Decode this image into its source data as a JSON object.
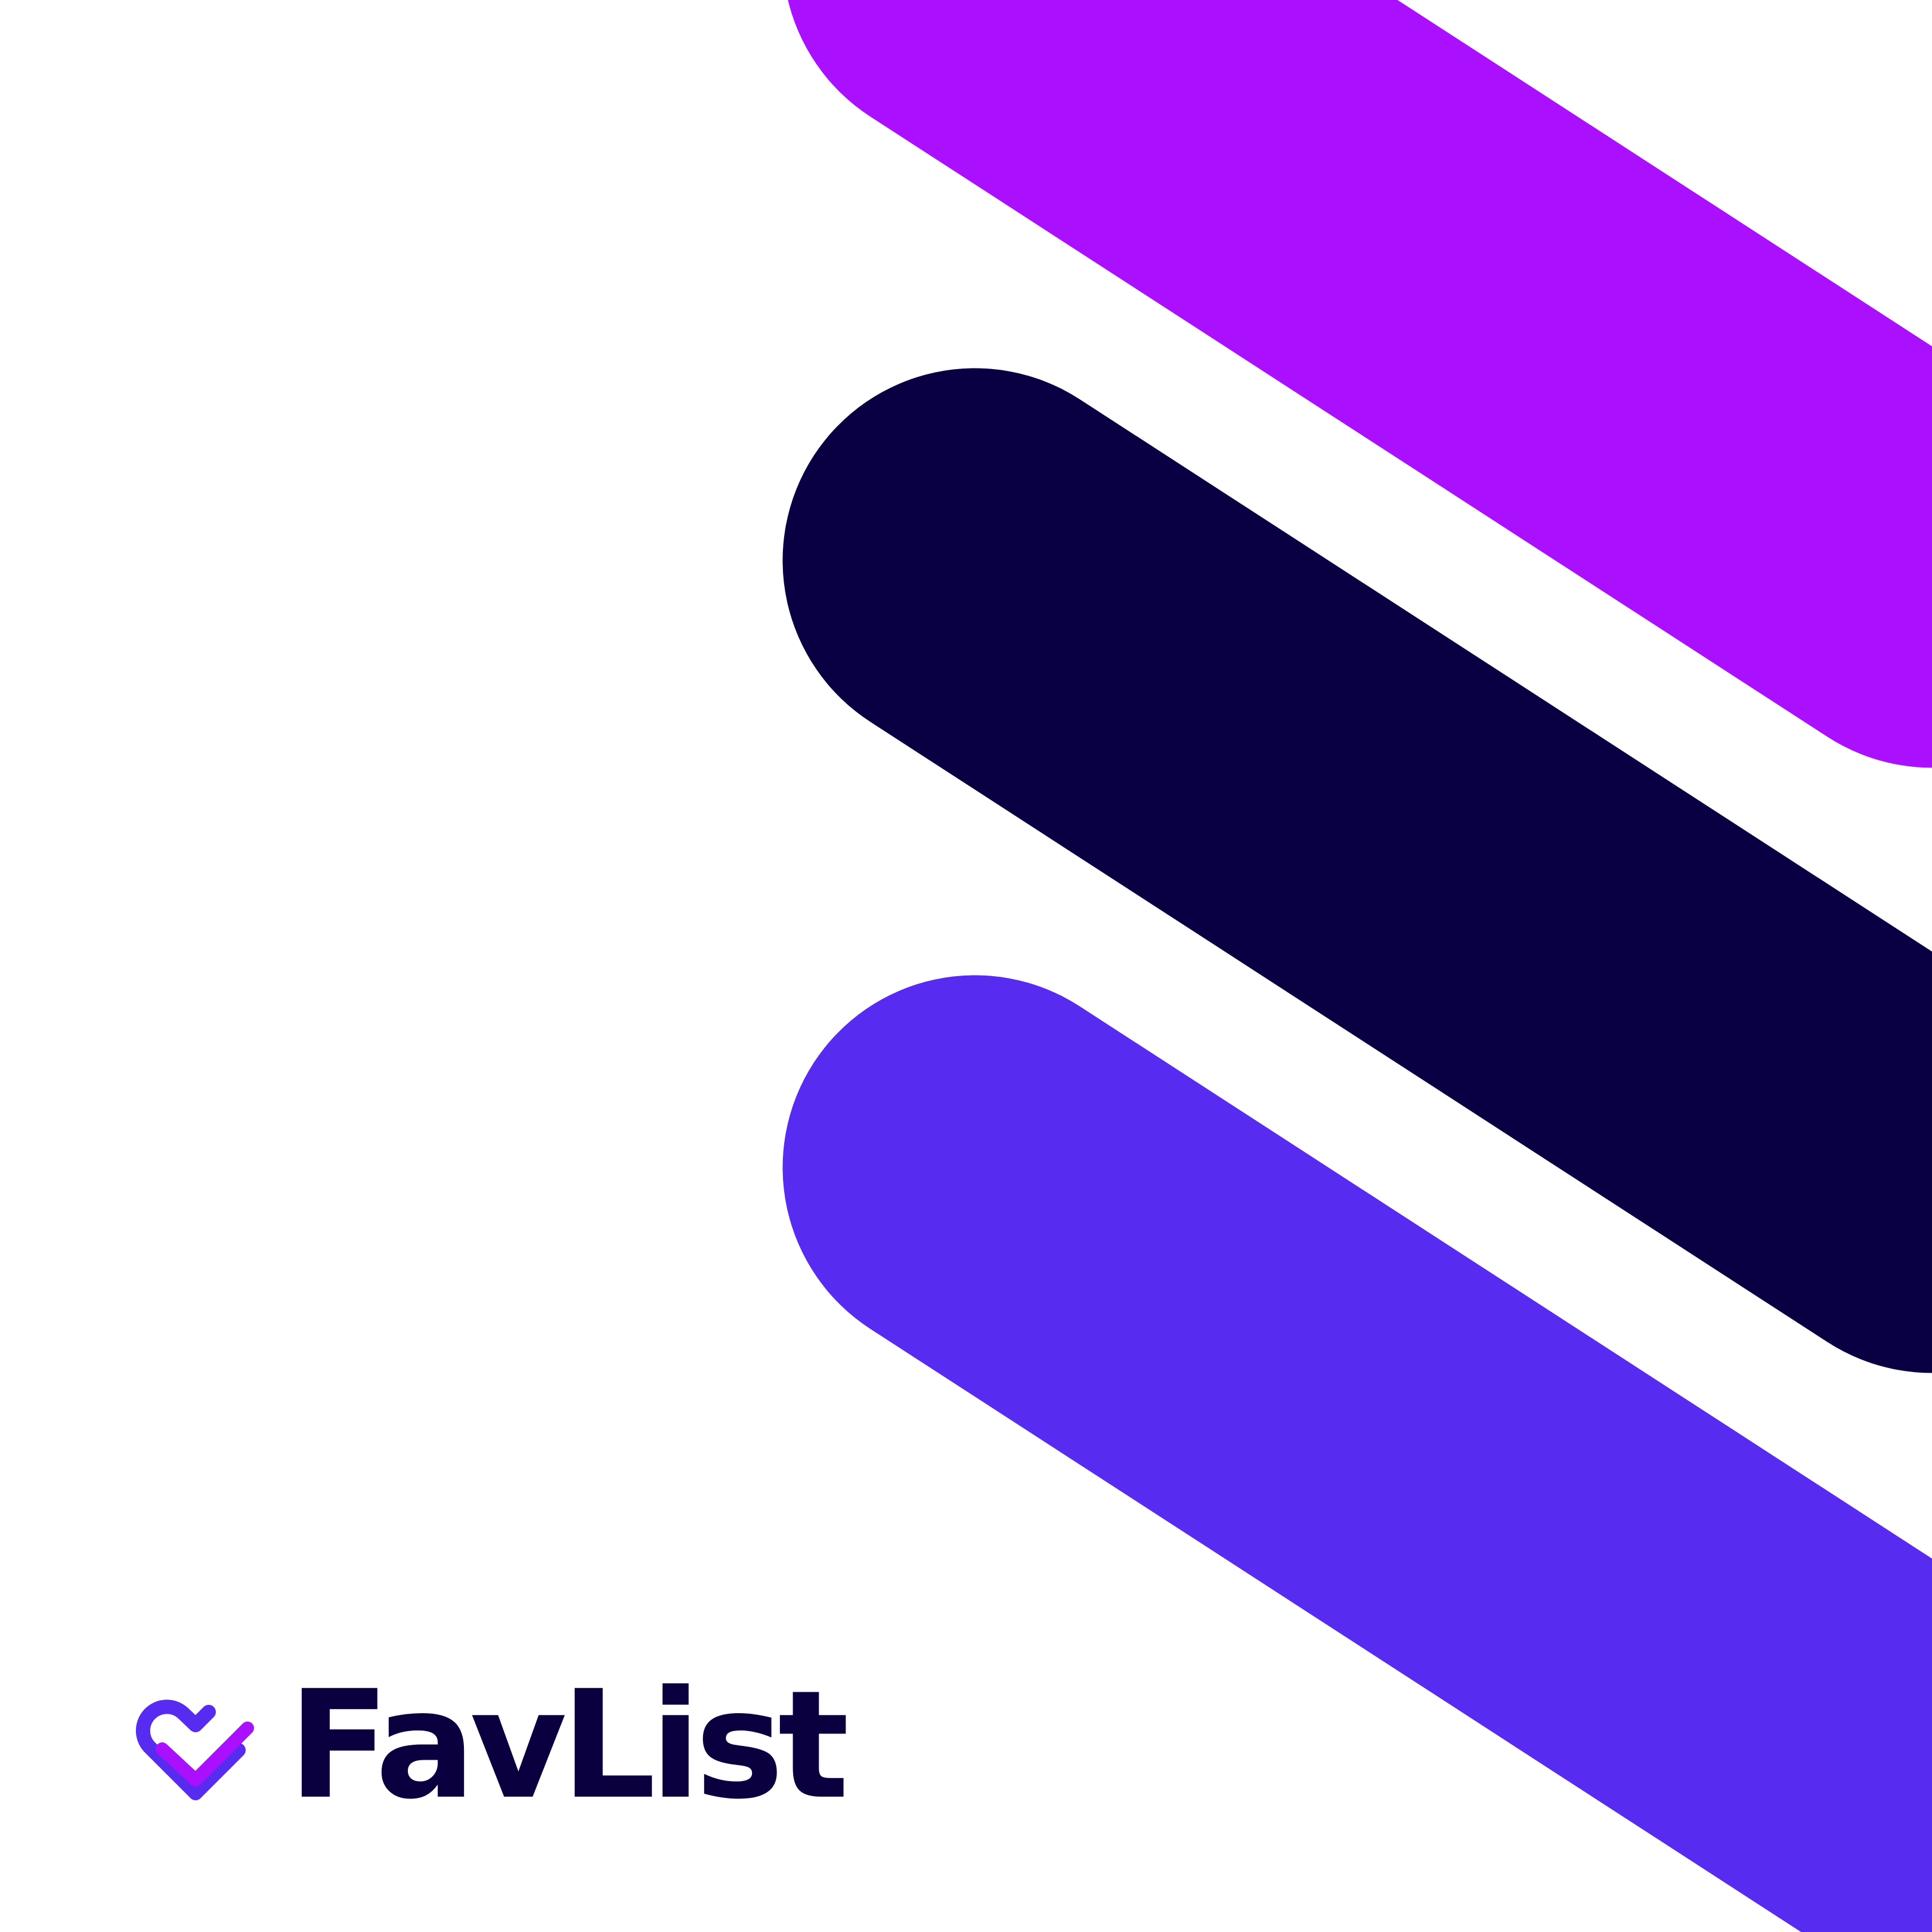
{
  "brand": {
    "name": "FavList",
    "logo_icon": "heart-check-icon"
  },
  "colors": {
    "background": "#ffffff",
    "stripe_top": "#ab10fe",
    "stripe_middle": "#080042",
    "stripe_bottom": "#582cf0",
    "wordmark": "#0a0040",
    "icon_heart": "#582cf0",
    "icon_check": "#ab10fe"
  }
}
